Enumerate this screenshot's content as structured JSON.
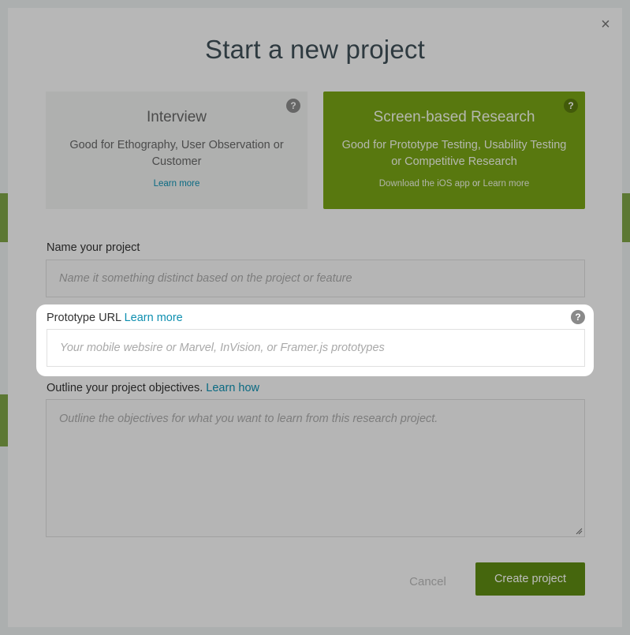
{
  "dialog": {
    "close_symbol": "×",
    "title": "Start a new project"
  },
  "cards": {
    "interview": {
      "title": "Interview",
      "description": "Good for Ethography, User Observation or Customer",
      "link": "Learn more",
      "help": "?"
    },
    "screen_based": {
      "title": "Screen-based Research",
      "description": "Good for Prototype Testing, Usability Testing or Competitive Research",
      "link_prefix": "Download the iOS app",
      "link_joiner": "or",
      "link": "Learn more",
      "help": "?",
      "selected": true,
      "color": "#77a315"
    }
  },
  "form": {
    "name": {
      "label": "Name your project",
      "placeholder": "Name it something distinct based on the project or feature"
    },
    "prototype_url": {
      "label": "Prototype URL",
      "link": "Learn more",
      "help": "?",
      "placeholder": "Your mobile websire or Marvel, InVision, or Framer.js prototypes"
    },
    "objectives": {
      "label": "Outline your project objectives.",
      "link": "Learn how",
      "placeholder": "Outline the objectives for what you want to learn from this research project."
    }
  },
  "actions": {
    "cancel": "Cancel",
    "create": "Create project",
    "create_color": "#5e8a12"
  },
  "link_color": "#0e8fb0"
}
